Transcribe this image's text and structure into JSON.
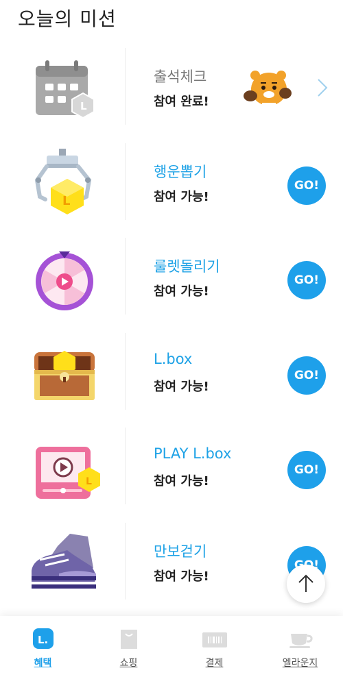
{
  "page": {
    "title": "오늘의 미션"
  },
  "missions": [
    {
      "title": "출석체크",
      "status": "참여 완료!",
      "icon": "attendance-calendar-icon",
      "action": "chevron"
    },
    {
      "title": "행운뽑기",
      "status": "참여 가능!",
      "icon": "claw-machine-icon",
      "action": "GO!"
    },
    {
      "title": "룰렛돌리기",
      "status": "참여 가능!",
      "icon": "roulette-wheel-icon",
      "action": "GO!"
    },
    {
      "title": "L.box",
      "status": "참여 가능!",
      "icon": "treasure-chest-icon",
      "action": "GO!"
    },
    {
      "title": "PLAY L.box",
      "status": "참여 가능!",
      "icon": "video-play-icon",
      "action": "GO!"
    },
    {
      "title": "만보걷기",
      "status": "참여 가능!",
      "icon": "sneaker-icon",
      "action": "GO!"
    }
  ],
  "nav": [
    {
      "label": "혜택",
      "icon": "benefits-icon",
      "active": true
    },
    {
      "label": "쇼핑",
      "icon": "shopping-bag-icon",
      "active": false
    },
    {
      "label": "결제",
      "icon": "barcode-card-icon",
      "active": false
    },
    {
      "label": "엘라운지",
      "icon": "coffee-cup-icon",
      "active": false
    }
  ],
  "colors": {
    "accent": "#1ea0ea",
    "coin": "#ffd400",
    "text": "#222222"
  }
}
